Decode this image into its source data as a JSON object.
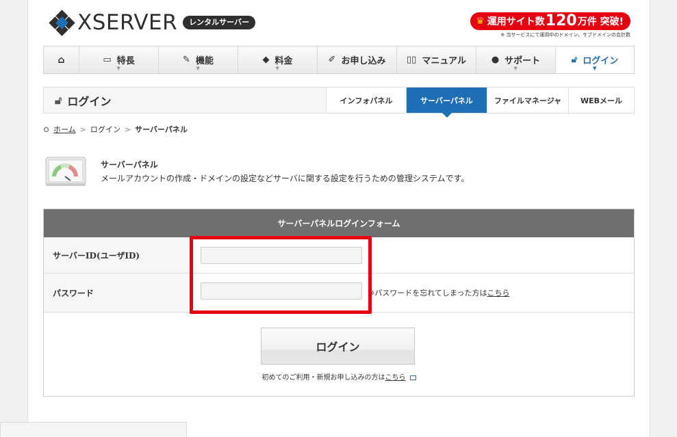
{
  "header": {
    "logo_text": "XSERVER",
    "logo_badge": "レンタルサーバー",
    "promo_text_1": "運用サイト数",
    "promo_text_2": "120",
    "promo_text_3": "万件 突破!",
    "promo_note": "※ 当サービスにて運用中のドメイン、サブドメインの合計数"
  },
  "gnav": {
    "items": [
      {
        "label": "",
        "icon": "home-icon"
      },
      {
        "label": "特長",
        "icon": "monitor-icon"
      },
      {
        "label": "機能",
        "icon": "tools-icon"
      },
      {
        "label": "料金",
        "icon": "tag-icon"
      },
      {
        "label": "お申し込み",
        "icon": "pencil-icon"
      },
      {
        "label": "マニュアル",
        "icon": "book-icon"
      },
      {
        "label": "サポート",
        "icon": "person-icon"
      },
      {
        "label": "ログイン",
        "icon": "unlock-icon"
      }
    ]
  },
  "subheader": {
    "title": "ログイン",
    "tabs": [
      {
        "label": "インフォパネル"
      },
      {
        "label": "サーバーパネル"
      },
      {
        "label": "ファイルマネージャ"
      },
      {
        "label": "WEBメール"
      }
    ]
  },
  "breadcrumb": {
    "home": "ホーム",
    "login": "ログイン",
    "current": "サーバーパネル"
  },
  "intro": {
    "title": "サーバーパネル",
    "desc": "メールアカウントの作成・ドメインの設定などサーバに関する設定を行うための管理システムです。"
  },
  "form": {
    "heading": "サーバーパネルログインフォーム",
    "id_label": "サーバーID(ユーザID)",
    "id_value": "",
    "password_label": "パスワード",
    "password_value": "",
    "forgot_prefix": "※パスワードを忘れてしまった方は",
    "forgot_link": "こちら",
    "login_button": "ログイン",
    "first_note_prefix": "初めてのご利用・新規お申し込みの方は",
    "first_note_link": "こちら"
  },
  "colors": {
    "accent_blue": "#1f6fb7",
    "highlight_red": "#e60012",
    "form_header": "#6f6f6f"
  }
}
